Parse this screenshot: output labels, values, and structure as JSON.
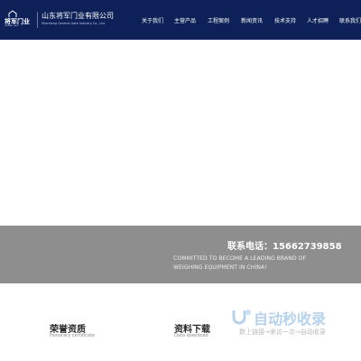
{
  "header": {
    "logo_text": "将军门业",
    "logo_sub": "GENERAL GATE",
    "company_name": "山东将军门业有限公司",
    "company_en": "Shandong General Gate Industry Co., Ltd.",
    "bg_color": "#0d2158"
  },
  "nav": {
    "items": [
      {
        "label": "关于我们"
      },
      {
        "label": "主营产品"
      },
      {
        "label": "工程案例"
      },
      {
        "label": "新闻资讯"
      },
      {
        "label": "技术支持"
      },
      {
        "label": "人才招聘"
      },
      {
        "label": "联系我们"
      }
    ]
  },
  "banner": {
    "contact": "联系电话：15662739858",
    "slogan": "COMMITTED TO BECOME A LEADING BRAND OF WEIGHING EQUIPMENT IN CHINA!",
    "slides": 3
  },
  "sections": [
    {
      "title": "荣誉资质",
      "subtitle": "Honorary certificate"
    },
    {
      "title": "资料下载",
      "subtitle": "Data download"
    }
  ],
  "watermark": {
    "title": "自动秒收录",
    "subtitle": "数上链接→来访一次→自动收录"
  }
}
